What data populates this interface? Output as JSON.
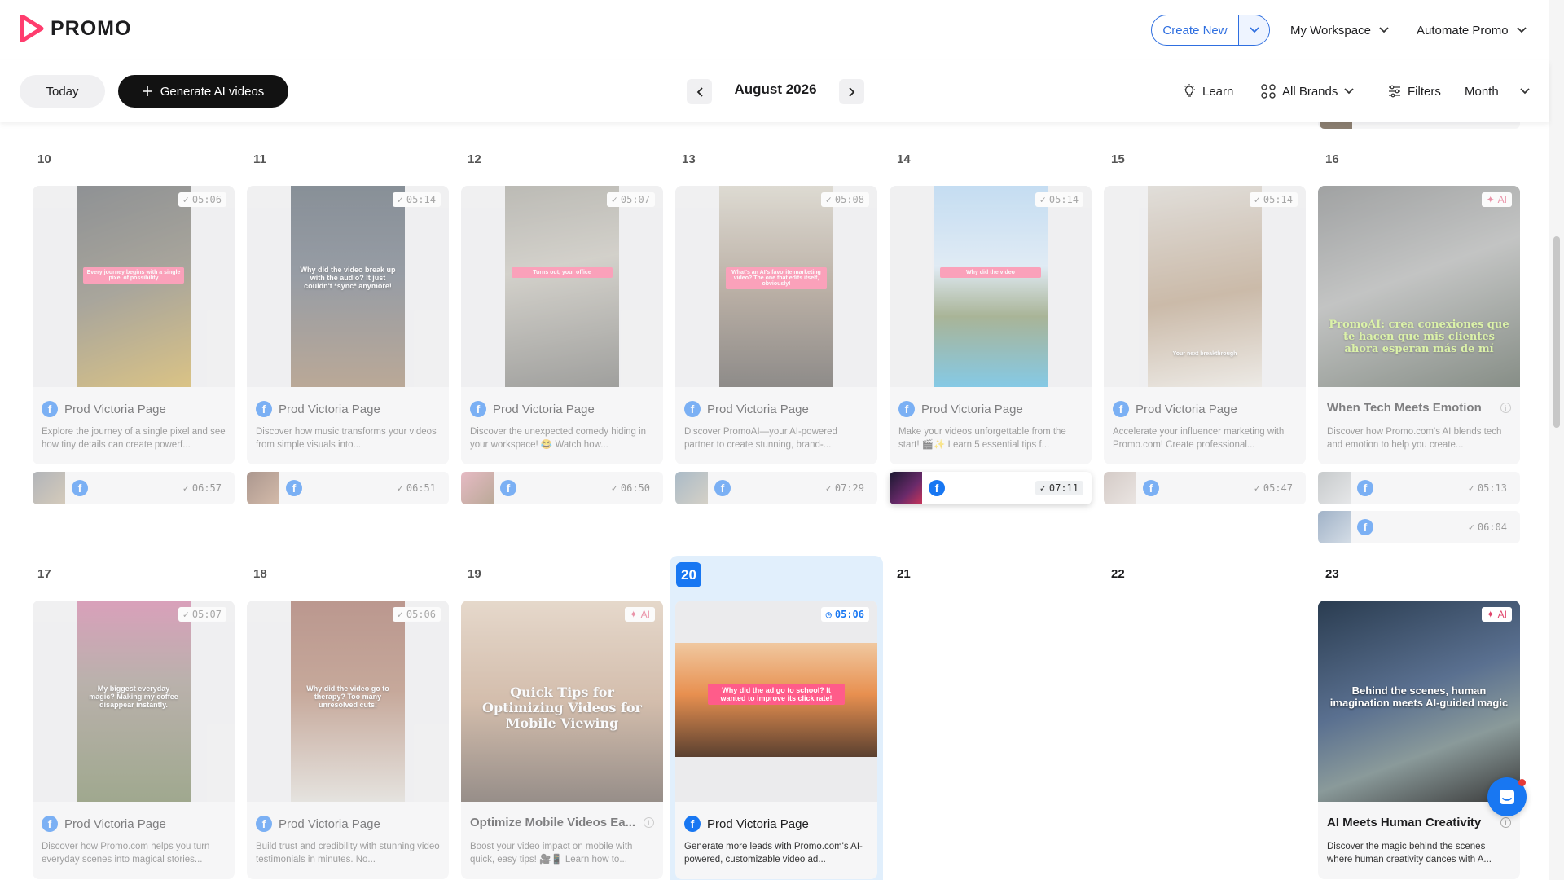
{
  "app": {
    "logo_text": "PROMO"
  },
  "header": {
    "create_new": "Create New",
    "workspace": "My Workspace",
    "automate": "Automate Promo"
  },
  "toolbar": {
    "today": "Today",
    "generate": "Generate AI videos",
    "month": "August 2026",
    "learn": "Learn",
    "brands": "All Brands",
    "filters": "Filters",
    "view": "Month"
  },
  "week1": {
    "days": [
      "10",
      "11",
      "12",
      "13",
      "14",
      "15",
      "16"
    ],
    "cards": [
      {
        "time": "05:06",
        "title": "Prod Victoria Page",
        "desc": "Explore the journey of a single pixel and see how tiny details can create powerf...",
        "caption": "Every journey begins with a single pixel of possibility",
        "mini_time": "06:57"
      },
      {
        "time": "05:14",
        "title": "Prod Victoria Page",
        "desc": "Discover how music transforms your videos from simple visuals into...",
        "caption": "Why did the video break up with the audio? It just couldn't *sync* anymore!",
        "mini_time": "06:51"
      },
      {
        "time": "05:07",
        "title": "Prod Victoria Page",
        "desc": "Discover the unexpected comedy hiding in your workspace! 😂 Watch how...",
        "caption": "Turns out, your office",
        "mini_time": "06:50"
      },
      {
        "time": "05:08",
        "title": "Prod Victoria Page",
        "desc": "Discover PromoAI—your AI-powered partner to create stunning, brand-...",
        "caption": "What's an AI's favorite marketing video? The one that edits itself, obviously!",
        "mini_time": "07:29"
      },
      {
        "time": "05:14",
        "title": "Prod Victoria Page",
        "desc": "Make your videos unforgettable from the start! 🎬✨ Learn 5 essential tips f...",
        "caption": "Why did the video",
        "mini_time": "07:11"
      },
      {
        "time": "05:14",
        "title": "Prod Victoria Page",
        "desc": "Accelerate your influencer marketing with Promo.com! Create professional...",
        "caption": "Your next breakthrough",
        "mini_time": "05:47"
      },
      {
        "ai": "AI",
        "title": "When Tech Meets Emotion",
        "desc": "Discover how Promo.com's AI blends tech and emotion to help you create...",
        "caption": "PromoAI: crea conexiones que te hacen que mis clientes ahora esperan más de mí",
        "mini_time": "05:13",
        "mini_time2": "06:04"
      }
    ]
  },
  "week2": {
    "days": [
      "17",
      "18",
      "19",
      "20",
      "21",
      "22",
      "23"
    ],
    "cards": [
      {
        "time": "05:07",
        "title": "Prod Victoria Page",
        "desc": "Discover how Promo.com helps you turn everyday scenes into magical stories...",
        "caption": "My biggest everyday magic? Making my coffee disappear instantly."
      },
      {
        "time": "05:06",
        "title": "Prod Victoria Page",
        "desc": "Build trust and credibility with stunning video testimonials in minutes. No...",
        "caption": "Why did the video go to therapy? Too many unresolved cuts!"
      },
      {
        "ai": "AI",
        "title": "Optimize Mobile Videos Ea...",
        "desc": "Boost your video impact on mobile with quick, easy tips! 🎥📱 Learn how to...",
        "caption": "Quick Tips for Optimizing Videos for Mobile Viewing"
      },
      {
        "time": "05:06",
        "title": "Prod Victoria Page",
        "desc": "Generate more leads with Promo.com's AI-powered, customizable video ad...",
        "caption": "Why did the ad go to school? It wanted to improve its click rate!"
      },
      {
        "ai": "AI",
        "title": "AI Meets Human Creativity",
        "desc": "Discover the magic behind the scenes where human creativity dances with A...",
        "caption": "Behind the scenes, human imagination meets AI-guided magic"
      }
    ]
  },
  "colors": {
    "accent": "#1877f2",
    "brand": "#e0446b",
    "primary_dark": "#121212"
  }
}
